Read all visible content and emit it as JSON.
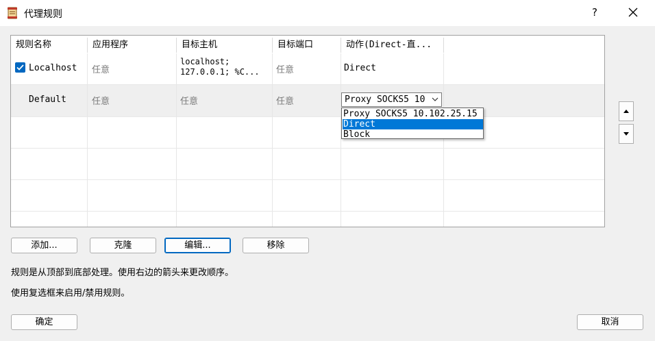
{
  "window": {
    "title": "代理规则",
    "help_label": "?"
  },
  "icons": {
    "app": "scroll-icon",
    "close": "close-icon",
    "up": "arrow-up-icon",
    "down": "arrow-down-icon",
    "chevron": "chevron-down-icon",
    "check": "check-icon"
  },
  "table": {
    "headers": [
      "规则名称",
      "应用程序",
      "目标主机",
      "目标端口",
      "动作(Direct-直..."
    ],
    "rows": [
      {
        "enabled": true,
        "name": "Localhost",
        "app": "任意",
        "host_line1": "localhost;",
        "host_line2": "127.0.0.1; %C...",
        "port": "任意",
        "action": "Direct"
      },
      {
        "name": "Default",
        "app": "任意",
        "host": "任意",
        "port": "任意",
        "action": "Proxy SOCKS5 10"
      }
    ]
  },
  "dropdown": {
    "options": [
      "Proxy SOCKS5 10.102.25.15",
      "Direct",
      "Block"
    ],
    "highlighted": "Direct"
  },
  "buttons": {
    "add": "添加...",
    "clone": "克隆",
    "edit": "编辑...",
    "remove": "移除",
    "ok": "确定",
    "cancel": "取消"
  },
  "info": {
    "line1": "规则是从顶部到底部处理。使用右边的箭头来更改顺序。",
    "line2": "使用复选框来启用/禁用规则。"
  },
  "colors": {
    "accent": "#0067c0",
    "selection": "#0078d7",
    "dialog_bg": "#f0f0f0"
  }
}
